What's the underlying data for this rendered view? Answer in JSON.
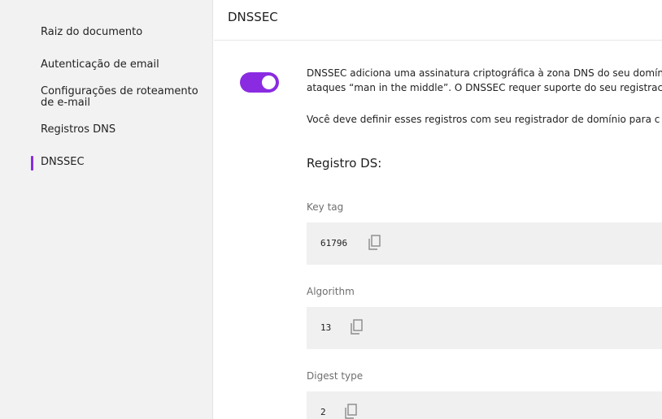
{
  "sidebar": {
    "items": [
      {
        "label": "Raiz do documento"
      },
      {
        "label": "Autenticação de email"
      },
      {
        "label": "Configurações de roteamento"
      },
      {
        "label": "de e-mail"
      },
      {
        "label": "Registros DNS"
      },
      {
        "label": "DNSSEC",
        "active": true
      }
    ]
  },
  "header": {
    "title": "DNSSEC"
  },
  "main": {
    "toggle": {
      "on": true
    },
    "description_line1": "DNSSEC adiciona uma assinatura criptográfica à zona DNS do seu domín",
    "description_line2": "ataques “man in the middle”. O DNSSEC requer suporte do seu registrac",
    "description_line3": "Você deve definir esses registros com seu registrador de domínio para c",
    "section_title": "Registro DS:",
    "fields": [
      {
        "label": "Key tag",
        "value": "61796"
      },
      {
        "label": "Algorithm",
        "value": "13"
      },
      {
        "label": "Digest type",
        "value": "2"
      }
    ]
  },
  "colors": {
    "accent": "#8a2be2",
    "sidebar_bg": "#f2f2f2",
    "field_bg": "#f0f0f0"
  }
}
